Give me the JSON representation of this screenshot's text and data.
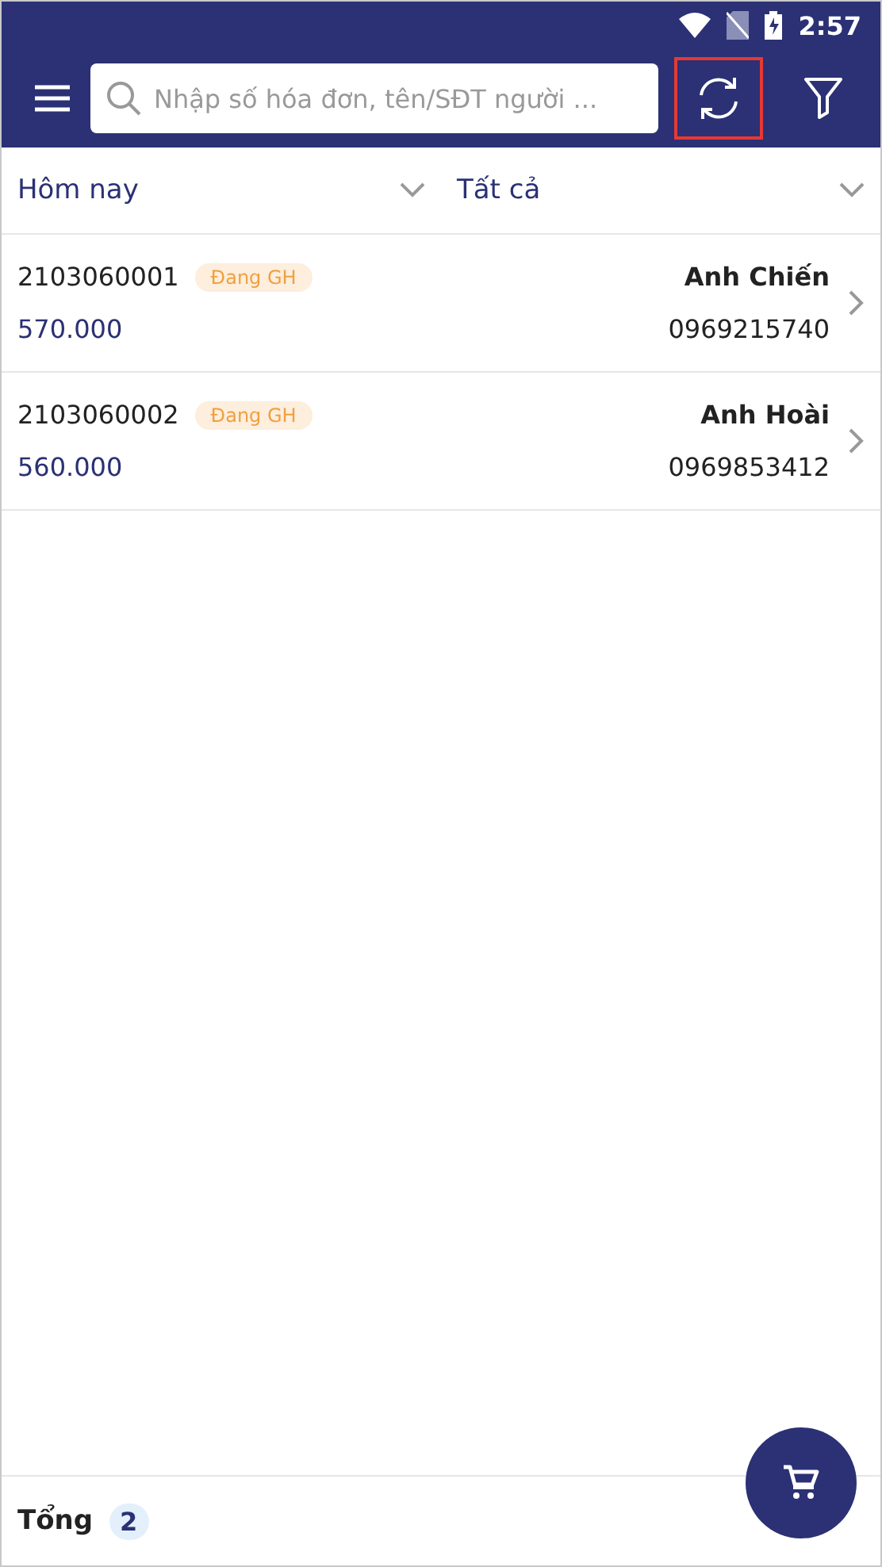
{
  "status_bar": {
    "time": "2:57"
  },
  "search": {
    "placeholder": "Nhập số hóa đơn, tên/SĐT người ..."
  },
  "refresh_button": {
    "highlighted": true
  },
  "filters": [
    {
      "label": "Hôm nay"
    },
    {
      "label": "Tất cả"
    }
  ],
  "orders": [
    {
      "code": "2103060001",
      "status": "Đang GH",
      "amount": "570.000",
      "customer": "Anh Chiến",
      "phone": "0969215740"
    },
    {
      "code": "2103060002",
      "status": "Đang GH",
      "amount": "560.000",
      "customer": "Anh Hoài",
      "phone": "0969853412"
    }
  ],
  "footer": {
    "label": "Tổng",
    "count": "2"
  }
}
